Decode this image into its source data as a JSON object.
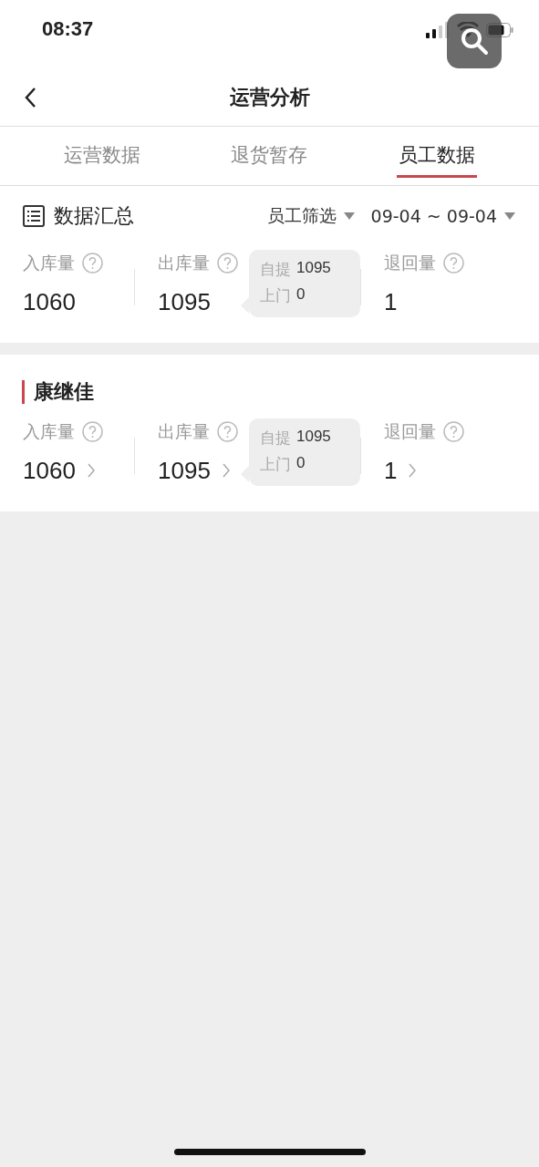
{
  "status_bar": {
    "time": "08:37"
  },
  "nav": {
    "title": "运营分析"
  },
  "tabs": [
    {
      "label": "运营数据",
      "selected": false
    },
    {
      "label": "退货暂存",
      "selected": false
    },
    {
      "label": "员工数据",
      "selected": true
    }
  ],
  "summary": {
    "title": "数据汇总",
    "filter": "员工筛选",
    "date_range": "09-04 ~ 09-04",
    "inbound": {
      "label": "入库量",
      "value": "1060",
      "linked": false
    },
    "outbound": {
      "label": "出库量",
      "value": "1095",
      "linked": false
    },
    "breakdown": [
      {
        "label": "自提",
        "value": "1095"
      },
      {
        "label": "上门",
        "value": "0"
      }
    ],
    "returned": {
      "label": "退回量",
      "value": "1",
      "linked": false
    }
  },
  "employees": [
    {
      "name": "康继佳",
      "inbound": {
        "label": "入库量",
        "value": "1060",
        "linked": true
      },
      "outbound": {
        "label": "出库量",
        "value": "1095",
        "linked": true
      },
      "breakdown": [
        {
          "label": "自提",
          "value": "1095"
        },
        {
          "label": "上门",
          "value": "0"
        }
      ],
      "returned": {
        "label": "退回量",
        "value": "1",
        "linked": true
      }
    }
  ]
}
